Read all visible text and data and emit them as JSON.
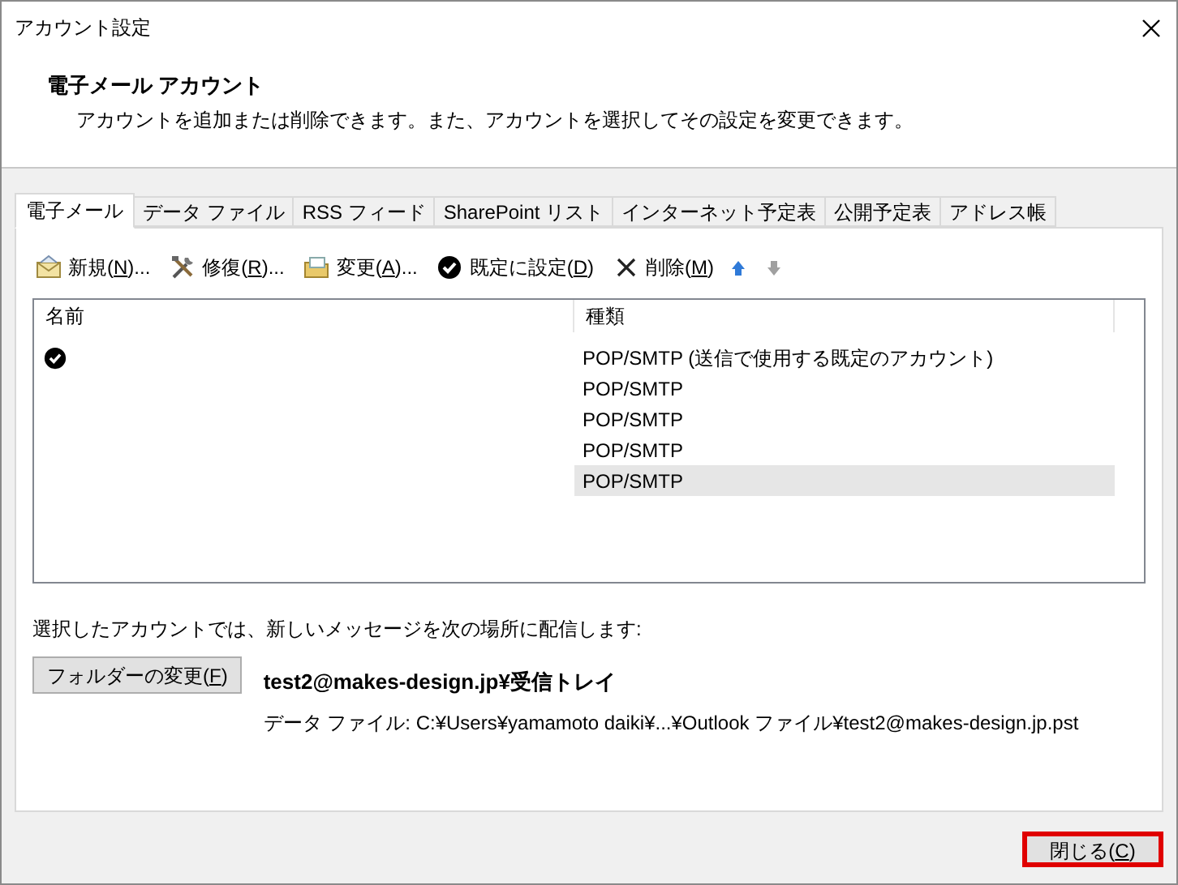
{
  "window": {
    "title": "アカウント設定"
  },
  "header": {
    "title": "電子メール アカウント",
    "description": "アカウントを追加または削除できます。また、アカウントを選択してその設定を変更できます。"
  },
  "tabs": [
    {
      "label": "電子メール",
      "selected": true
    },
    {
      "label": "データ ファイル",
      "selected": false
    },
    {
      "label": "RSS フィード",
      "selected": false
    },
    {
      "label": "SharePoint リスト",
      "selected": false
    },
    {
      "label": "インターネット予定表",
      "selected": false
    },
    {
      "label": "公開予定表",
      "selected": false
    },
    {
      "label": "アドレス帳",
      "selected": false
    }
  ],
  "toolbar": [
    {
      "kind": "new",
      "before": "新規(",
      "mnemonic": "N",
      "after": ")..."
    },
    {
      "kind": "repair",
      "before": "修復(",
      "mnemonic": "R",
      "after": ")..."
    },
    {
      "kind": "change",
      "before": "変更(",
      "mnemonic": "A",
      "after": ")..."
    },
    {
      "kind": "default",
      "before": "既定に設定(",
      "mnemonic": "D",
      "after": ")"
    },
    {
      "kind": "delete",
      "before": "削除(",
      "mnemonic": "M",
      "after": ")"
    },
    {
      "kind": "up",
      "disabled": false
    },
    {
      "kind": "down",
      "disabled": true
    }
  ],
  "table": {
    "columns": [
      "名前",
      "種類"
    ],
    "rows": [
      {
        "type": "POP/SMTP (送信で使用する既定のアカウント)",
        "default": true,
        "selected": false
      },
      {
        "type": "POP/SMTP",
        "default": false,
        "selected": false
      },
      {
        "type": "POP/SMTP",
        "default": false,
        "selected": false
      },
      {
        "type": "POP/SMTP",
        "default": false,
        "selected": false
      },
      {
        "type": "POP/SMTP",
        "default": false,
        "selected": true
      }
    ]
  },
  "delivery": {
    "label": "選択したアカウントでは、新しいメッセージを次の場所に配信します:",
    "button": {
      "before": "フォルダーの変更(",
      "mnemonic": "F",
      "after": ")"
    },
    "folder": "test2@makes-design.jp¥受信トレイ",
    "data_file": "データ ファイル: C:¥Users¥yamamoto daiki¥...¥Outlook ファイル¥test2@makes-design.jp.pst"
  },
  "close_button": {
    "before": "閉じる(",
    "mnemonic": "C",
    "after": ")",
    "highlighted": true
  }
}
